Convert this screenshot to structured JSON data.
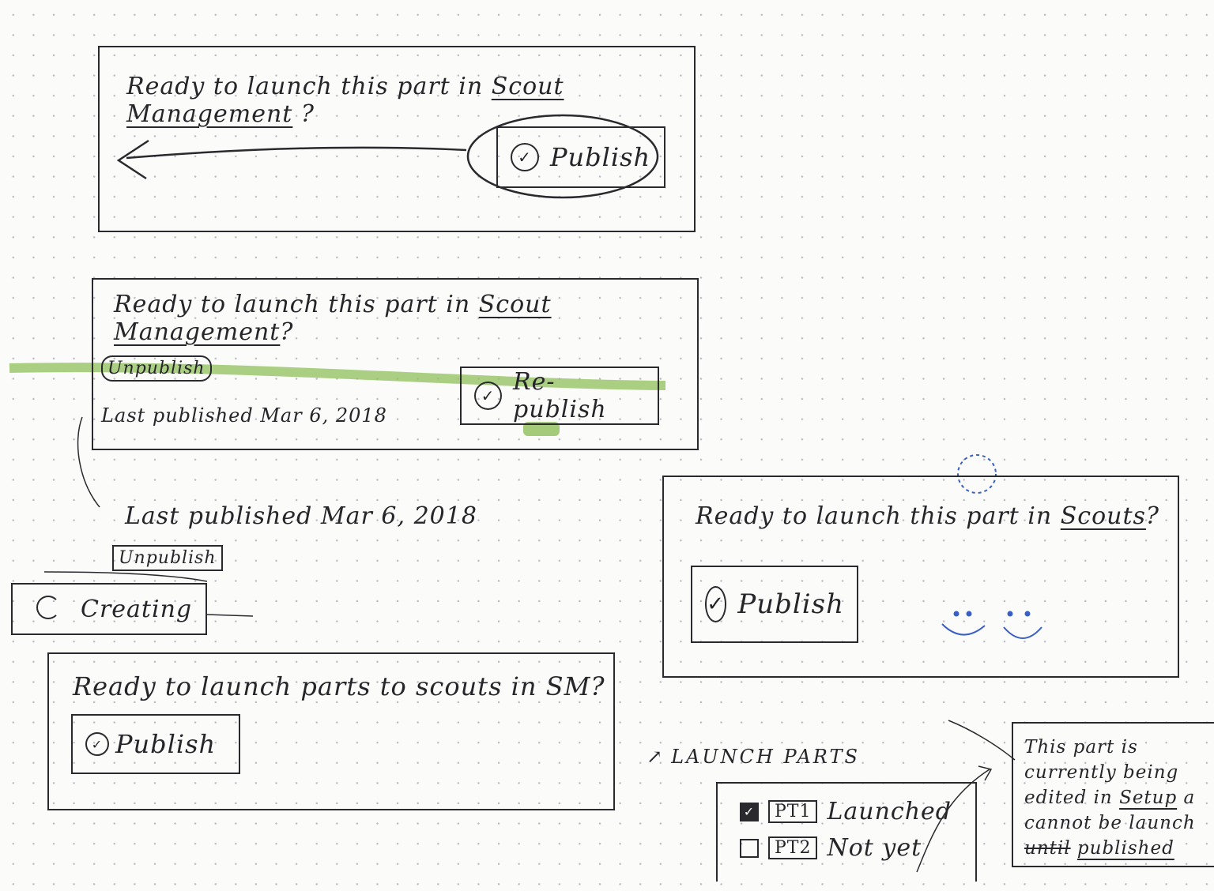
{
  "panel1": {
    "prompt": "Ready to launch this part in ",
    "app_link": "Scout Management",
    "prompt_end": " ?",
    "publish_label": "Publish",
    "check_glyph": "✓"
  },
  "panel2": {
    "prompt": "Ready to launch this part in ",
    "app_link": "Scout Management",
    "prompt_end": "?",
    "unpublish_label": "Unpublish",
    "last_published": "Last published Mar 6, 2018",
    "republish_label": "Re-publish",
    "check_glyph": "✓"
  },
  "detail": {
    "last_published": "Last published Mar 6, 2018",
    "unpublish_label": "Unpublish",
    "creating_label": "Creating"
  },
  "panel3": {
    "prompt": "Ready to launch this part in ",
    "app_link": "Scouts",
    "prompt_end": "?",
    "publish_label": "Publish",
    "check_glyph": "✓"
  },
  "panel4": {
    "prompt": "Ready to launch parts to scouts in SM?",
    "publish_label": "Publish",
    "check_glyph": "✓"
  },
  "launch_parts": {
    "title": "LAUNCH PARTS",
    "parts": [
      {
        "tag": "PT1",
        "status": "Launched",
        "checked": true
      },
      {
        "tag": "PT2",
        "status": "Not yet",
        "checked": false
      }
    ]
  },
  "tooltip": {
    "line1": "This part is",
    "line2": "currently being",
    "line3_prefix": "edited in ",
    "line3_link": "Setup",
    "line3_suffix": " a",
    "line4": "cannot be launch",
    "line5_struck": "until",
    "line5_rest": "published"
  },
  "colors": {
    "ink": "#2a2a2e",
    "highlighter": "#8fbf5a",
    "blue_pen": "#3a5fc4"
  }
}
